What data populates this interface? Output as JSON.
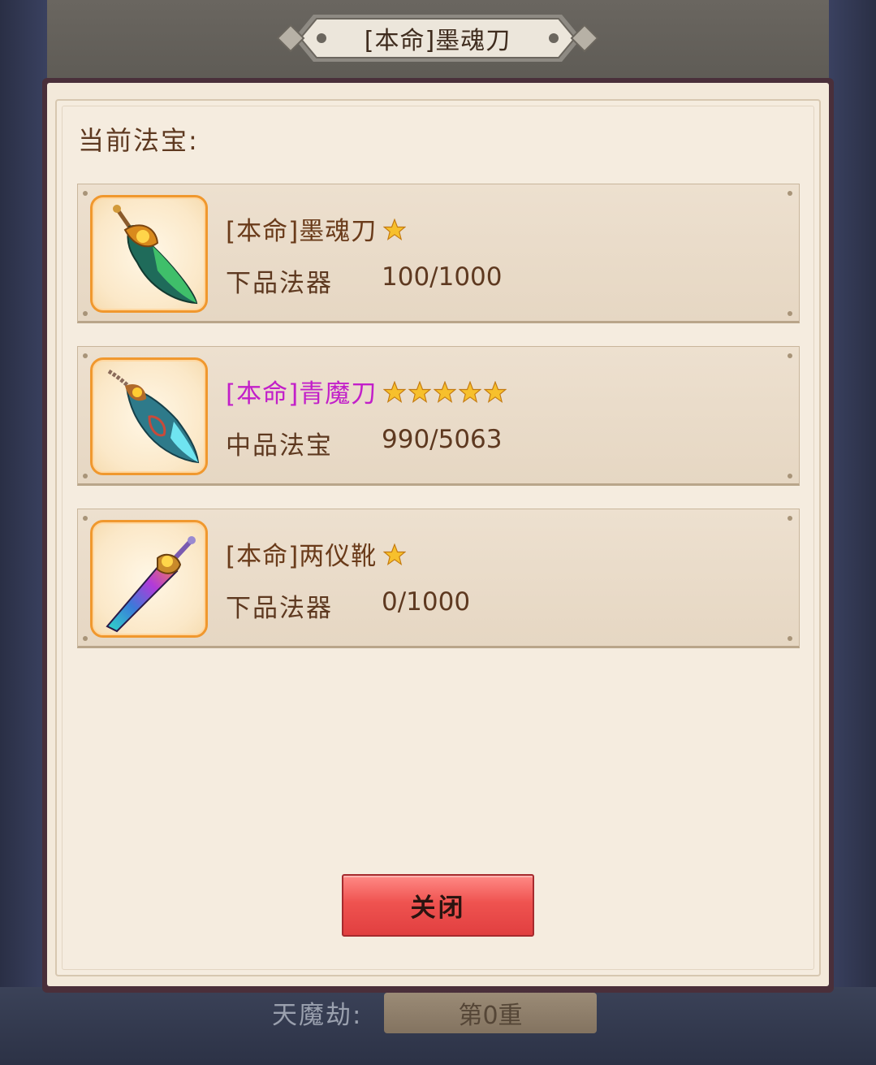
{
  "window": {
    "title": "[本命]墨魂刀"
  },
  "dialog": {
    "section_label": "当前法宝:",
    "items": [
      {
        "name": "[本命]墨魂刀",
        "stars": 1,
        "grade": "下品法器",
        "count": "100/1000",
        "name_color": "#6a3b1a",
        "icon": "green-blade-icon"
      },
      {
        "name": "[本命]青魔刀",
        "stars": 5,
        "grade": "中品法宝",
        "count": "990/5063",
        "name_color": "#c21fc9",
        "icon": "cyan-blade-icon"
      },
      {
        "name": "[本命]两仪靴",
        "stars": 1,
        "grade": "下品法器",
        "count": "0/1000",
        "name_color": "#6a3b1a",
        "icon": "rainbow-sword-icon"
      }
    ],
    "close_label": "关闭"
  },
  "background": {
    "row_label": "天魔劫:",
    "row_value": "第0重"
  },
  "colors": {
    "accent": "#ef5350",
    "text_brown": "#5e3920",
    "highlight_purple": "#c21fc9",
    "icon_border": "#f0982e"
  }
}
